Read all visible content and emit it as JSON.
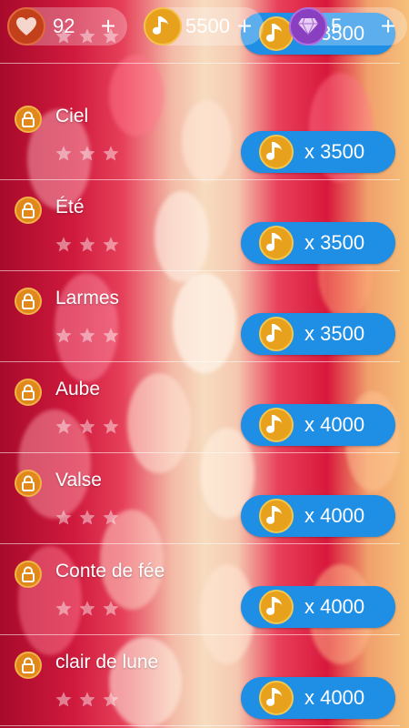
{
  "topbar": {
    "lives": {
      "value": "92",
      "plus": "+"
    },
    "notes": {
      "value": "5500",
      "plus": "+"
    },
    "gems": {
      "value": "5",
      "plus": "+"
    }
  },
  "songs": [
    {
      "title": "",
      "stars_earned": 0,
      "stars_total": 3,
      "price": "x 3500",
      "locked": true
    },
    {
      "title": "Ciel",
      "stars_earned": 0,
      "stars_total": 3,
      "price": "x 3500",
      "locked": true
    },
    {
      "title": "Été",
      "stars_earned": 0,
      "stars_total": 3,
      "price": "x 3500",
      "locked": true
    },
    {
      "title": "Larmes",
      "stars_earned": 0,
      "stars_total": 3,
      "price": "x 3500",
      "locked": true
    },
    {
      "title": "Aube",
      "stars_earned": 0,
      "stars_total": 3,
      "price": "x 4000",
      "locked": true
    },
    {
      "title": "Valse",
      "stars_earned": 0,
      "stars_total": 3,
      "price": "x 4000",
      "locked": true
    },
    {
      "title": "Conte de fée",
      "stars_earned": 0,
      "stars_total": 3,
      "price": "x 4000",
      "locked": true
    },
    {
      "title": "clair de lune",
      "stars_earned": 0,
      "stars_total": 3,
      "price": "x 4000",
      "locked": true
    }
  ],
  "icons": {
    "lives": "heart-icon",
    "notes": "music-note-icon",
    "gems": "diamond-icon",
    "lock": "lock-icon",
    "star": "star-icon"
  },
  "colors": {
    "buy_button": "#1f8fe6",
    "coin": "#e8a11c",
    "lock": "#e0891a",
    "heart": "#c2401a",
    "gem": "#8a3ec0"
  }
}
